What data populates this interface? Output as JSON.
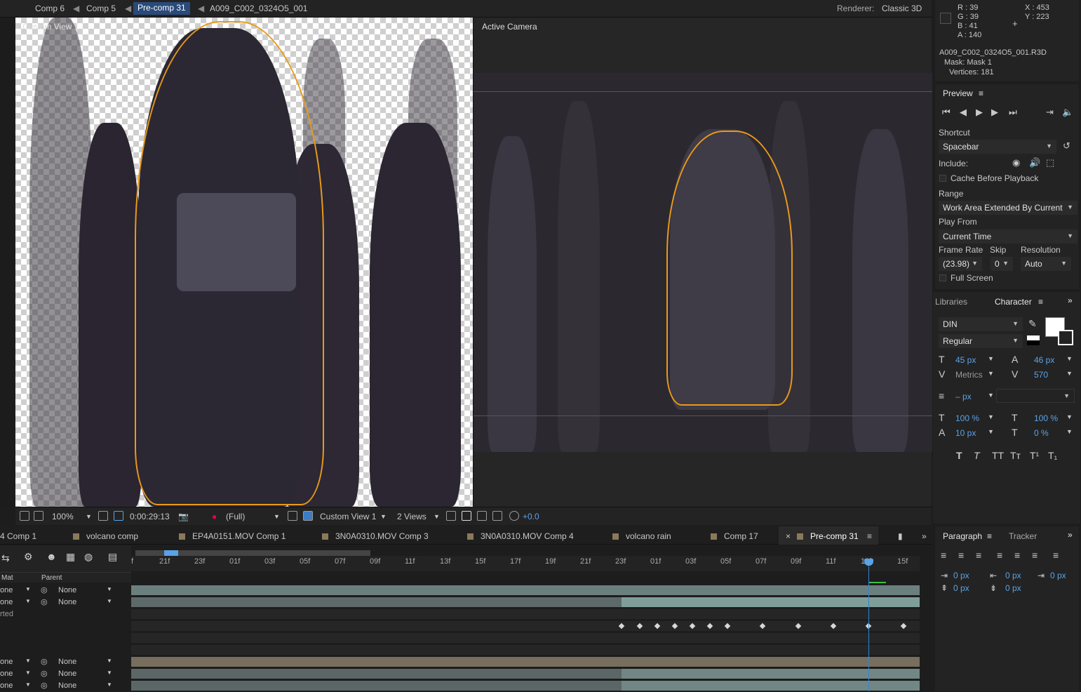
{
  "breadcrumbs": [
    "Comp 6",
    "Comp 5",
    "Pre-comp 31",
    "A009_C002_0324O5_001"
  ],
  "renderer": {
    "label": "Renderer:",
    "value": "Classic 3D"
  },
  "views": {
    "left_label": "Custom View 1",
    "right_label": "Active Camera"
  },
  "view_toolbar": {
    "zoom": "100%",
    "timecode": "0:00:29:13",
    "resolution": "(Full)",
    "view": "Custom View 1",
    "layout": "2 Views",
    "exposure": "+0.0"
  },
  "info": {
    "r": "R : 39",
    "g": "G : 39",
    "b": "B : 41",
    "a": "A : 140",
    "x": "X : 453",
    "y": "Y : 223",
    "file": "A009_C002_0324O5_001.R3D",
    "mask": "Mask: Mask 1",
    "vertices": "Vertices: 181"
  },
  "preview": {
    "title": "Preview",
    "shortcut_label": "Shortcut",
    "shortcut": "Spacebar",
    "include_label": "Include:",
    "cache": "Cache Before Playback",
    "range_label": "Range",
    "range": "Work Area Extended By Current",
    "play_from_label": "Play From",
    "play_from": "Current Time",
    "frame_rate_label": "Frame Rate",
    "skip_label": "Skip",
    "resolution_label": "Resolution",
    "frame_rate": "(23.98)",
    "skip": "0",
    "resolution": "Auto",
    "full_screen": "Full Screen"
  },
  "character": {
    "tab_libraries": "Libraries",
    "tab_character": "Character",
    "font": "DIN",
    "style": "Regular",
    "size": "45 px",
    "leading": "46 px",
    "kerning": "Metrics",
    "tracking": "570",
    "stroke": "– px",
    "vscale": "100 %",
    "hscale": "100 %",
    "baseline": "10 px",
    "tsume": "0 %"
  },
  "paragraph": {
    "tab_paragraph": "Paragraph",
    "tab_tracker": "Tracker",
    "indent_left": "0 px",
    "indent_right": "0 px",
    "indent_first": "0 px",
    "space_before": "0 px",
    "space_after": "0 px"
  },
  "timeline_tabs": [
    "4 Comp 1",
    "volcano comp",
    "EP4A0151.MOV Comp 1",
    "3N0A0310.MOV Comp 3",
    "3N0A0310.MOV Comp 4",
    "volcano rain",
    "Comp 17",
    "Pre-comp 31"
  ],
  "ruler_ticks": [
    "f",
    "21f",
    "23f",
    "01f",
    "03f",
    "05f",
    "07f",
    "09f",
    "11f",
    "13f",
    "15f",
    "17f",
    "19f",
    "21f",
    "23f",
    "01f",
    "03f",
    "05f",
    "07f",
    "09f",
    "11f",
    "13f",
    "15f"
  ],
  "columns": {
    "mat": "Mat",
    "parent": "Parent"
  },
  "layers": [
    {
      "mat": "one",
      "parent": "None"
    },
    {
      "mat": "one",
      "parent": "None"
    },
    {
      "mat": "rted",
      "parent": ""
    },
    {
      "mat": "one",
      "parent": "None"
    },
    {
      "mat": "one",
      "parent": "None"
    },
    {
      "mat": "one",
      "parent": "None"
    }
  ]
}
